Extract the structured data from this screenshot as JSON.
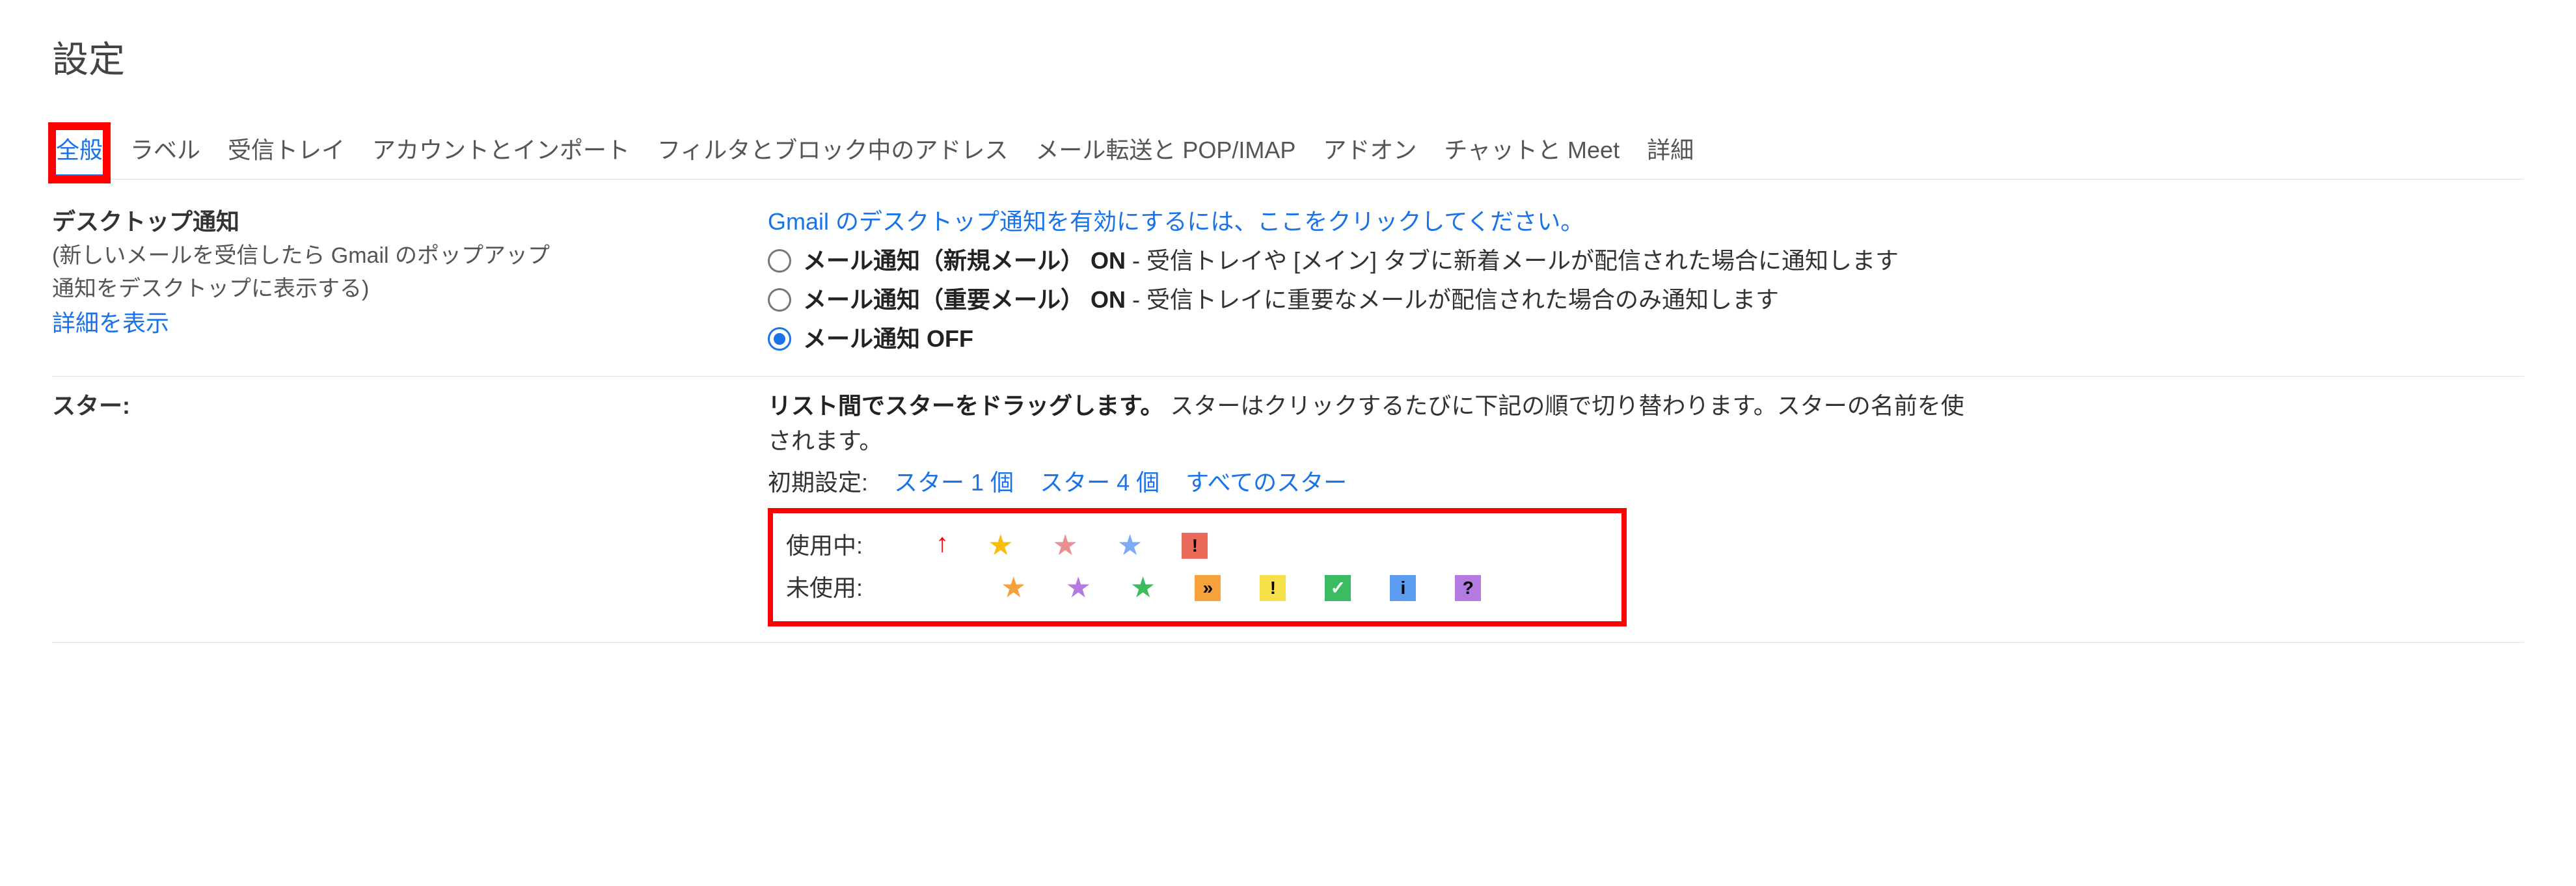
{
  "page": {
    "title": "設定"
  },
  "tabs": {
    "general": "全般",
    "labels": "ラベル",
    "inbox": "受信トレイ",
    "accounts": "アカウントとインポート",
    "filters": "フィルタとブロック中のアドレス",
    "forward": "メール転送と POP/IMAP",
    "addons": "アドオン",
    "chat": "チャットと Meet",
    "advanced": "詳細"
  },
  "desktop": {
    "heading": "デスクトップ通知",
    "sub1": "(新しいメールを受信したら Gmail のポップアップ",
    "sub2": "通知をデスクトップに表示する)",
    "learn_more": "詳細を表示",
    "enable_link": "Gmail のデスクトップ通知を有効にするには、ここをクリックしてください。",
    "opt1_bold": "メール通知（新規メール） ON",
    "opt1_rest": " - 受信トレイや [メイン] タブに新着メールが配信された場合に通知します",
    "opt2_bold": "メール通知（重要メール） ON",
    "opt2_rest": " - 受信トレイに重要なメールが配信された場合のみ通知します",
    "opt3_bold": "メール通知 OFF"
  },
  "stars": {
    "heading": "スター:",
    "desc_bold": "リスト間でスターをドラッグします。",
    "desc_rest": " スターはクリックするたびに下記の順で切り替わります。スターの名前を使",
    "desc_rest2": "されます。",
    "presets_label": "初期設定:",
    "preset1": "スター 1 個",
    "preset4": "スター 4 個",
    "preset_all": "すべてのスター",
    "in_use_label": "使用中:",
    "not_used_label": "未使用:"
  },
  "stars_data": {
    "in_use": [
      "star-yellow",
      "star-red",
      "star-blue",
      "square-red-bang"
    ],
    "not_used": [
      "star-orange",
      "star-purple",
      "star-green",
      "square-orange-gt",
      "square-yellow-bang",
      "square-green-check",
      "square-blue-i",
      "square-purple-q"
    ]
  },
  "colors": {
    "link": "#1a73e8",
    "highlight": "#ff0000"
  }
}
